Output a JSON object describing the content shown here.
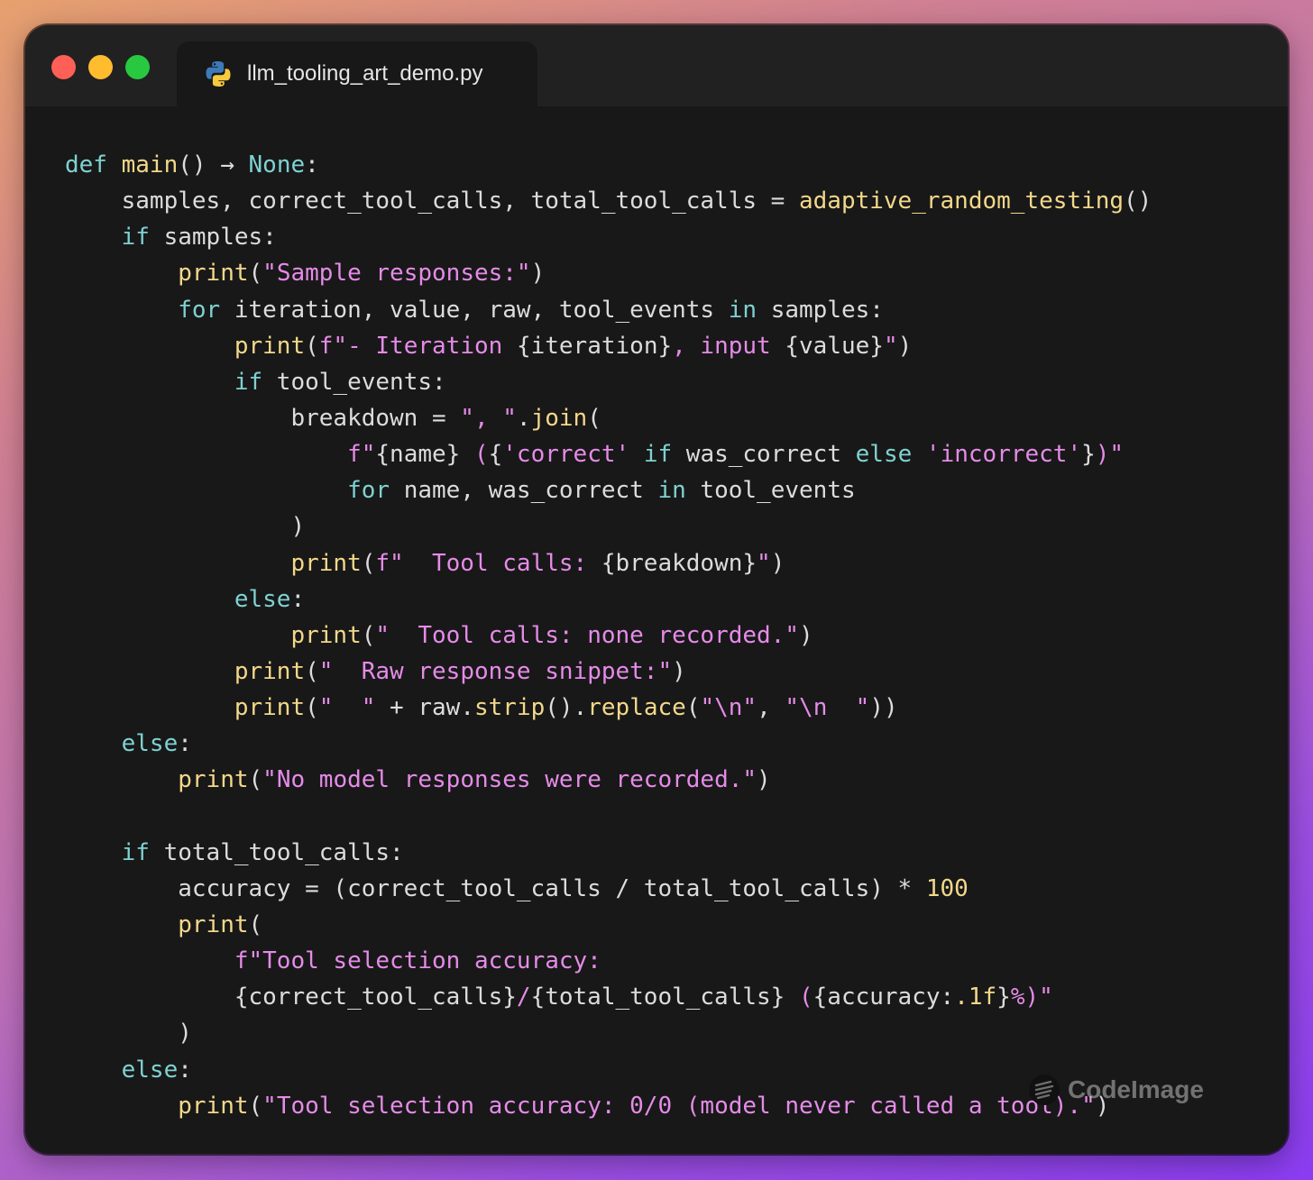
{
  "window": {
    "tab_title": "llm_tooling_art_demo.py",
    "icon": "python-icon"
  },
  "colors": {
    "keyword": "#7fd1d1",
    "function": "#f3d88a",
    "string": "#e58be8",
    "text": "#dcdcdc",
    "background": "#181818",
    "titlebar": "#212121"
  },
  "watermark": {
    "text": "CodeImage",
    "icon": "codeimage-logo-icon"
  },
  "code_lines": [
    [
      [
        "kw",
        "def "
      ],
      [
        "fn",
        "main"
      ],
      [
        "t",
        "() → "
      ],
      [
        "kw",
        "None"
      ],
      [
        "t",
        ":"
      ]
    ],
    [
      [
        "t",
        "    samples, correct_tool_calls, total_tool_calls = "
      ],
      [
        "fn",
        "adaptive_random_testing"
      ],
      [
        "t",
        "()"
      ]
    ],
    [
      [
        "t",
        "    "
      ],
      [
        "kw",
        "if"
      ],
      [
        "t",
        " samples:"
      ]
    ],
    [
      [
        "t",
        "        "
      ],
      [
        "fn",
        "print"
      ],
      [
        "t",
        "("
      ],
      [
        "str",
        "\"Sample responses:\""
      ],
      [
        "t",
        ")"
      ]
    ],
    [
      [
        "t",
        "        "
      ],
      [
        "kw",
        "for"
      ],
      [
        "t",
        " iteration, value, raw, tool_events "
      ],
      [
        "kw",
        "in"
      ],
      [
        "t",
        " samples:"
      ]
    ],
    [
      [
        "t",
        "            "
      ],
      [
        "fn",
        "print"
      ],
      [
        "t",
        "("
      ],
      [
        "str",
        "f\"- Iteration "
      ],
      [
        "t",
        "{iteration}"
      ],
      [
        "str",
        ", input "
      ],
      [
        "t",
        "{value}"
      ],
      [
        "str",
        "\""
      ],
      [
        "t",
        ")"
      ]
    ],
    [
      [
        "t",
        "            "
      ],
      [
        "kw",
        "if"
      ],
      [
        "t",
        " tool_events:"
      ]
    ],
    [
      [
        "t",
        "                breakdown = "
      ],
      [
        "str",
        "\", \""
      ],
      [
        "t",
        "."
      ],
      [
        "fn",
        "join"
      ],
      [
        "t",
        "("
      ]
    ],
    [
      [
        "t",
        "                    "
      ],
      [
        "str",
        "f\""
      ],
      [
        "t",
        "{name}"
      ],
      [
        "str",
        " ("
      ],
      [
        "t",
        "{"
      ],
      [
        "str",
        "'correct'"
      ],
      [
        "t",
        " "
      ],
      [
        "kw",
        "if"
      ],
      [
        "t",
        " was_correct "
      ],
      [
        "kw",
        "else"
      ],
      [
        "t",
        " "
      ],
      [
        "str",
        "'incorrect'"
      ],
      [
        "t",
        "}"
      ],
      [
        "str",
        ")\""
      ]
    ],
    [
      [
        "t",
        "                    "
      ],
      [
        "kw",
        "for"
      ],
      [
        "t",
        " name, was_correct "
      ],
      [
        "kw",
        "in"
      ],
      [
        "t",
        " tool_events"
      ]
    ],
    [
      [
        "t",
        "                )"
      ]
    ],
    [
      [
        "t",
        "                "
      ],
      [
        "fn",
        "print"
      ],
      [
        "t",
        "("
      ],
      [
        "str",
        "f\"  Tool calls: "
      ],
      [
        "t",
        "{breakdown}"
      ],
      [
        "str",
        "\""
      ],
      [
        "t",
        ")"
      ]
    ],
    [
      [
        "t",
        "            "
      ],
      [
        "kw",
        "else"
      ],
      [
        "t",
        ":"
      ]
    ],
    [
      [
        "t",
        "                "
      ],
      [
        "fn",
        "print"
      ],
      [
        "t",
        "("
      ],
      [
        "str",
        "\"  Tool calls: none recorded.\""
      ],
      [
        "t",
        ")"
      ]
    ],
    [
      [
        "t",
        "            "
      ],
      [
        "fn",
        "print"
      ],
      [
        "t",
        "("
      ],
      [
        "str",
        "\"  Raw response snippet:\""
      ],
      [
        "t",
        ")"
      ]
    ],
    [
      [
        "t",
        "            "
      ],
      [
        "fn",
        "print"
      ],
      [
        "t",
        "("
      ],
      [
        "str",
        "\"  \""
      ],
      [
        "t",
        " + raw."
      ],
      [
        "fn",
        "strip"
      ],
      [
        "t",
        "()."
      ],
      [
        "fn",
        "replace"
      ],
      [
        "t",
        "("
      ],
      [
        "str",
        "\"\\n\""
      ],
      [
        "t",
        ", "
      ],
      [
        "str",
        "\"\\n  \""
      ],
      [
        "t",
        "))"
      ]
    ],
    [
      [
        "t",
        "    "
      ],
      [
        "kw",
        "else"
      ],
      [
        "t",
        ":"
      ]
    ],
    [
      [
        "t",
        "        "
      ],
      [
        "fn",
        "print"
      ],
      [
        "t",
        "("
      ],
      [
        "str",
        "\"No model responses were recorded.\""
      ],
      [
        "t",
        ")"
      ]
    ],
    [
      [
        "t",
        ""
      ]
    ],
    [
      [
        "t",
        "    "
      ],
      [
        "kw",
        "if"
      ],
      [
        "t",
        " total_tool_calls:"
      ]
    ],
    [
      [
        "t",
        "        accuracy = (correct_tool_calls / total_tool_calls) * "
      ],
      [
        "num",
        "100"
      ]
    ],
    [
      [
        "t",
        "        "
      ],
      [
        "fn",
        "print"
      ],
      [
        "t",
        "("
      ]
    ],
    [
      [
        "t",
        "            "
      ],
      [
        "str",
        "f\"Tool selection accuracy:"
      ]
    ],
    [
      [
        "t",
        "            {correct_tool_calls}"
      ],
      [
        "str",
        "/"
      ],
      [
        "t",
        "{total_tool_calls}"
      ],
      [
        "str",
        " ("
      ],
      [
        "t",
        "{accuracy:"
      ],
      [
        "num",
        ".1f"
      ],
      [
        "t",
        "}"
      ],
      [
        "str",
        "%)\""
      ]
    ],
    [
      [
        "t",
        "        )"
      ]
    ],
    [
      [
        "t",
        "    "
      ],
      [
        "kw",
        "else"
      ],
      [
        "t",
        ":"
      ]
    ],
    [
      [
        "t",
        "        "
      ],
      [
        "fn",
        "print"
      ],
      [
        "t",
        "("
      ],
      [
        "str",
        "\"Tool selection accuracy: 0/0 (model never called a tool).\""
      ],
      [
        "t",
        ")"
      ]
    ]
  ]
}
